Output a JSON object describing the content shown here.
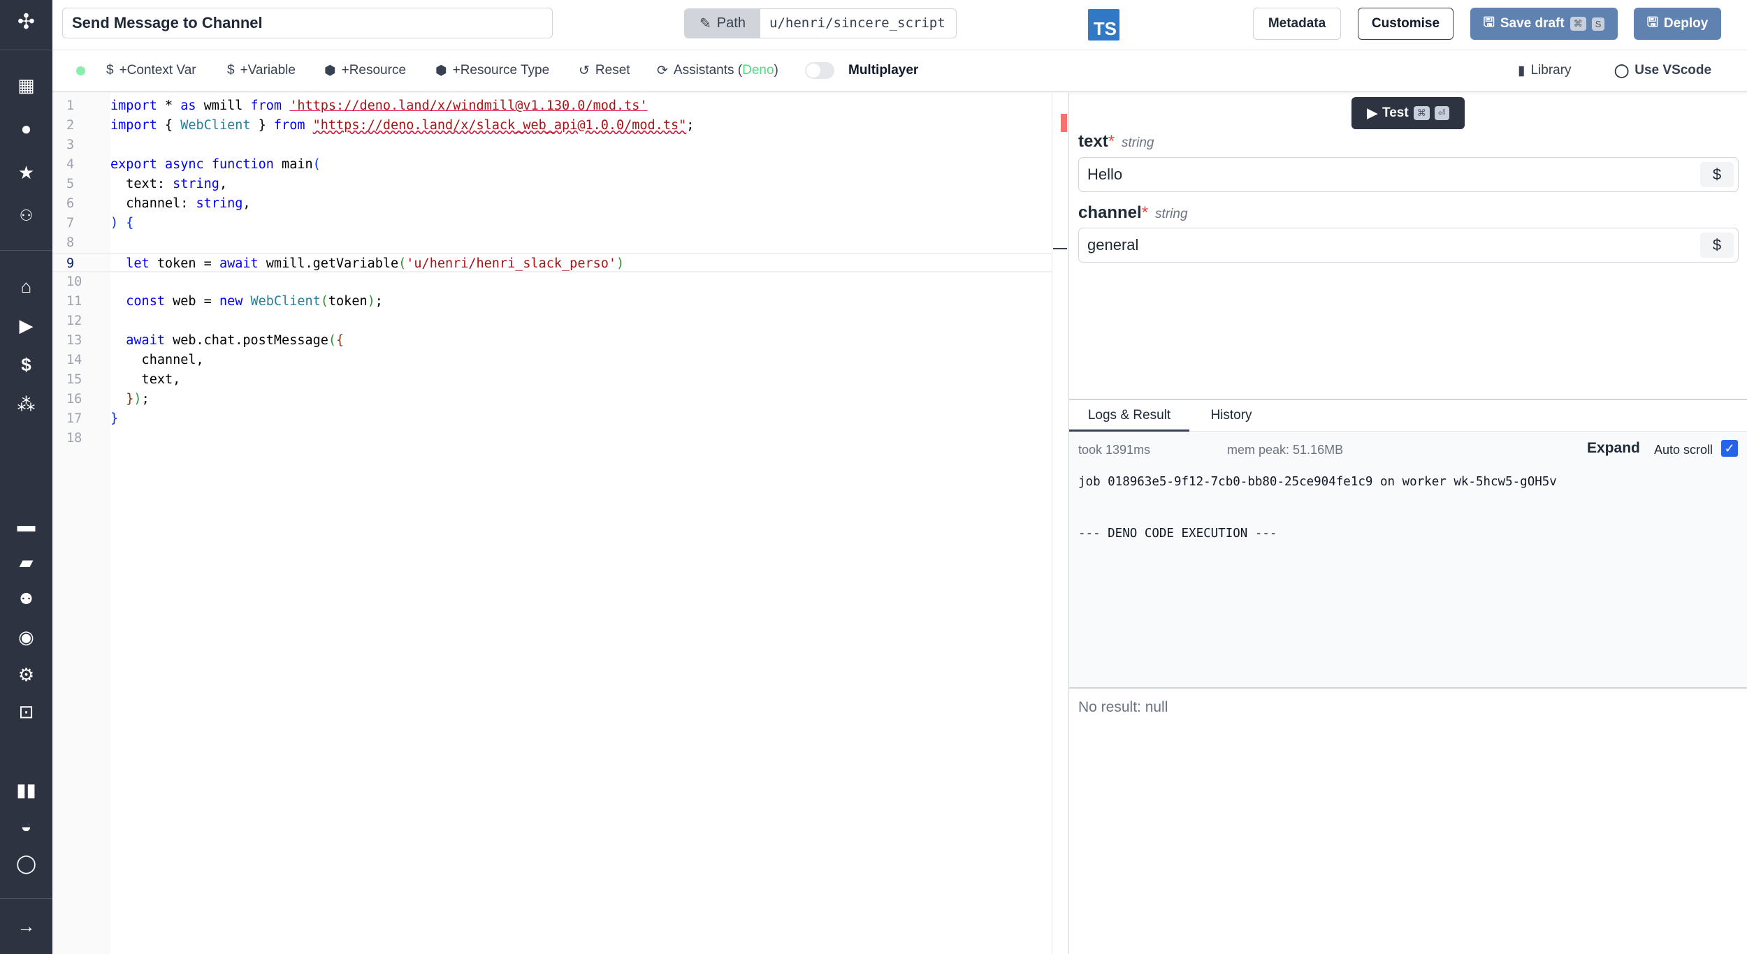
{
  "sidebar": {
    "logo": "windmill-logo",
    "items": [
      {
        "icon": "building-icon"
      },
      {
        "icon": "user-icon"
      },
      {
        "icon": "star-icon"
      },
      {
        "icon": "users-icon"
      },
      {
        "icon": "home-icon"
      },
      {
        "icon": "play-icon"
      },
      {
        "icon": "dollar-icon"
      },
      {
        "icon": "cubes-icon"
      },
      {
        "icon": "calendar-icon"
      },
      {
        "icon": "folder-icon"
      },
      {
        "icon": "groups-icon"
      },
      {
        "icon": "eye-icon"
      },
      {
        "icon": "gear-icon"
      },
      {
        "icon": "robot-icon"
      },
      {
        "icon": "book-icon"
      },
      {
        "icon": "discord-icon"
      },
      {
        "icon": "github-icon"
      }
    ],
    "expand_icon": "arrow-right-icon"
  },
  "header": {
    "title": "Send Message to Channel",
    "path_label": "Path",
    "path_value": "u/henri/sincere_script",
    "language_badge": "TS",
    "metadata": "Metadata",
    "customise": "Customise",
    "save_draft": "Save draft",
    "save_kbd": [
      "⌘",
      "S"
    ],
    "deploy": "Deploy"
  },
  "toolbar": {
    "context_var": "+Context Var",
    "variable": "+Variable",
    "resource": "+Resource",
    "resource_type": "+Resource Type",
    "reset": "Reset",
    "assistants": "Assistants",
    "assistants_lang": "Deno",
    "multiplayer": "Multiplayer",
    "multiplayer_on": false,
    "library": "Library",
    "use_vscode": "Use VScode"
  },
  "editor": {
    "current_line": 9,
    "lines": [
      [
        {
          "t": "import",
          "k": "keyword"
        },
        {
          "t": " * ",
          "k": "plain"
        },
        {
          "t": "as",
          "k": "keyword"
        },
        {
          "t": " wmill ",
          "k": "plain"
        },
        {
          "t": "from",
          "k": "keyword"
        },
        {
          "t": " ",
          "k": "plain"
        },
        {
          "t": "'https://deno.land/x/windmill@v1.130.0/mod.ts'",
          "k": "string",
          "u": "und"
        }
      ],
      [
        {
          "t": "import",
          "k": "keyword"
        },
        {
          "t": " { ",
          "k": "plain"
        },
        {
          "t": "WebClient",
          "k": "type"
        },
        {
          "t": " } ",
          "k": "plain"
        },
        {
          "t": "from",
          "k": "keyword"
        },
        {
          "t": " ",
          "k": "plain"
        },
        {
          "t": "\"https://deno.land/x/slack_web_api@1.0.0/mod.ts\"",
          "k": "string",
          "u": "wavy"
        },
        {
          "t": ";",
          "k": "plain"
        }
      ],
      [],
      [
        {
          "t": "export",
          "k": "keyword"
        },
        {
          "t": " ",
          "k": "plain"
        },
        {
          "t": "async",
          "k": "keyword"
        },
        {
          "t": " ",
          "k": "plain"
        },
        {
          "t": "function",
          "k": "keyword"
        },
        {
          "t": " main",
          "k": "plain"
        },
        {
          "t": "(",
          "k": "bracket"
        }
      ],
      [
        {
          "t": "  text: ",
          "k": "plain"
        },
        {
          "t": "string",
          "k": "keyword"
        },
        {
          "t": ",",
          "k": "plain"
        }
      ],
      [
        {
          "t": "  channel: ",
          "k": "plain"
        },
        {
          "t": "string",
          "k": "keyword"
        },
        {
          "t": ",",
          "k": "plain"
        }
      ],
      [
        {
          "t": ")",
          "k": "bracket"
        },
        {
          "t": " ",
          "k": "plain"
        },
        {
          "t": "{",
          "k": "bracket"
        }
      ],
      [],
      [
        {
          "t": "  ",
          "k": "plain"
        },
        {
          "t": "let",
          "k": "keyword"
        },
        {
          "t": " token = ",
          "k": "plain"
        },
        {
          "t": "await",
          "k": "keyword"
        },
        {
          "t": " wmill.getVariable",
          "k": "plain"
        },
        {
          "t": "(",
          "k": "paren"
        },
        {
          "t": "'u/henri/henri_slack_perso'",
          "k": "string"
        },
        {
          "t": ")",
          "k": "paren"
        }
      ],
      [],
      [
        {
          "t": "  ",
          "k": "plain"
        },
        {
          "t": "const",
          "k": "keyword"
        },
        {
          "t": " web = ",
          "k": "plain"
        },
        {
          "t": "new",
          "k": "keyword"
        },
        {
          "t": " ",
          "k": "plain"
        },
        {
          "t": "WebClient",
          "k": "type"
        },
        {
          "t": "(",
          "k": "paren"
        },
        {
          "t": "token",
          "k": "plain"
        },
        {
          "t": ")",
          "k": "paren"
        },
        {
          "t": ";",
          "k": "plain"
        }
      ],
      [],
      [
        {
          "t": "  ",
          "k": "plain"
        },
        {
          "t": "await",
          "k": "keyword"
        },
        {
          "t": " web.chat.postMessage",
          "k": "plain"
        },
        {
          "t": "(",
          "k": "paren"
        },
        {
          "t": "{",
          "k": "brace"
        }
      ],
      [
        {
          "t": "    channel,",
          "k": "plain"
        }
      ],
      [
        {
          "t": "    text,",
          "k": "plain"
        }
      ],
      [
        {
          "t": "  ",
          "k": "plain"
        },
        {
          "t": "}",
          "k": "brace"
        },
        {
          "t": ")",
          "k": "paren"
        },
        {
          "t": ";",
          "k": "plain"
        }
      ],
      [
        {
          "t": "}",
          "k": "bracket"
        }
      ],
      []
    ]
  },
  "test": {
    "label": "Test",
    "kbd": [
      "⌘",
      "⏎"
    ]
  },
  "args": [
    {
      "name": "text",
      "required": "*",
      "type": "string",
      "value": "Hello"
    },
    {
      "name": "channel",
      "required": "*",
      "type": "string",
      "value": "general"
    }
  ],
  "results": {
    "tabs": [
      "Logs & Result",
      "History"
    ],
    "took": "took 1391ms",
    "mem_peak": "mem peak: 51.16MB",
    "expand": "Expand",
    "auto_scroll": "Auto scroll",
    "auto_scroll_checked": true,
    "log_lines": [
      "job 018963e5-9f12-7cb0-bb80-25ce904fe1c9 on worker wk-5hcw5-gOH5v",
      "--- DENO CODE EXECUTION ---"
    ],
    "result": "No result: null"
  },
  "colors": {
    "sidebar": "#2e3341",
    "primary_button": "#5f82b0",
    "ts_badge": "#3178c6",
    "status_dot": "#86efac",
    "checkbox": "#2563eb"
  }
}
